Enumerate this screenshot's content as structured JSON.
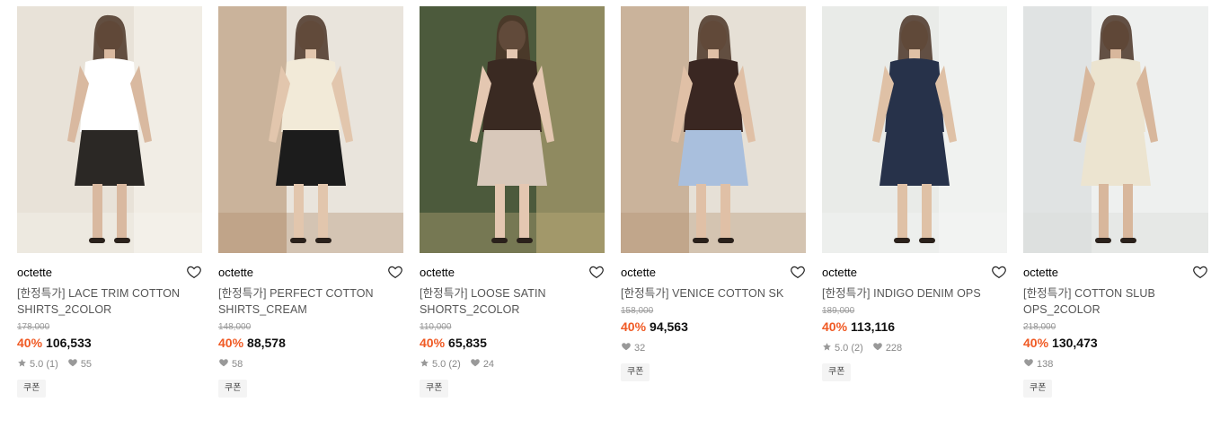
{
  "products": [
    {
      "brand": "octette",
      "name": "[한정특가] LACE TRIM COTTON SHIRTS_2COLOR",
      "original_price": "178,000",
      "discount": "40%",
      "price": "106,533",
      "rating": "5.0",
      "reviews": "(1)",
      "likes": "55",
      "coupon": "쿠폰",
      "image": {
        "bg": "#e8e2d8",
        "accent": "#f7f5f1",
        "garment": "#ffffff",
        "lower": "#2b2825",
        "skin": "#d9b9a0"
      }
    },
    {
      "brand": "octette",
      "name": "[한정특가] PERFECT COTTON SHIRTS_CREAM",
      "original_price": "148,000",
      "discount": "40%",
      "price": "88,578",
      "rating": "",
      "reviews": "",
      "likes": "58",
      "coupon": "쿠폰",
      "image": {
        "bg": "#e9e4dc",
        "accent": "#b08a66",
        "garment": "#f2ead8",
        "lower": "#1c1c1c",
        "skin": "#e2c6ad"
      }
    },
    {
      "brand": "octette",
      "name": "[한정특가] LOOSE SATIN SHORTS_2COLOR",
      "original_price": "110,000",
      "discount": "40%",
      "price": "65,835",
      "rating": "5.0",
      "reviews": "(2)",
      "likes": "24",
      "coupon": "쿠폰",
      "image": {
        "bg": "#4c5a3c",
        "accent": "#c7b27d",
        "garment": "#3a2a22",
        "lower": "#d8c8ba",
        "skin": "#e4c7b1"
      }
    },
    {
      "brand": "octette",
      "name": "[한정특가] VENICE COTTON SK",
      "original_price": "158,000",
      "discount": "40%",
      "price": "94,563",
      "rating": "",
      "reviews": "",
      "likes": "32",
      "coupon": "쿠폰",
      "image": {
        "bg": "#e6e0d6",
        "accent": "#b28e6c",
        "garment": "#3a2722",
        "lower": "#a9bfdd",
        "skin": "#e0c0a6"
      }
    },
    {
      "brand": "octette",
      "name": "[한정특가] INDIGO DENIM OPS",
      "original_price": "189,000",
      "discount": "40%",
      "price": "113,116",
      "rating": "5.0",
      "reviews": "(2)",
      "likes": "228",
      "coupon": "쿠폰",
      "image": {
        "bg": "#e9ebe8",
        "accent": "#f6f7f5",
        "garment": "#27324a",
        "lower": "#27324a",
        "skin": "#dfc1a6"
      }
    },
    {
      "brand": "octette",
      "name": "[한정특가] COTTON SLUB OPS_2COLOR",
      "original_price": "218,000",
      "discount": "40%",
      "price": "130,473",
      "rating": "",
      "reviews": "",
      "likes": "138",
      "coupon": "쿠폰",
      "image": {
        "bg": "#eef0ef",
        "accent": "#d6d9d8",
        "garment": "#ece4d0",
        "lower": "#ece4d0",
        "skin": "#d8b79c"
      }
    }
  ]
}
